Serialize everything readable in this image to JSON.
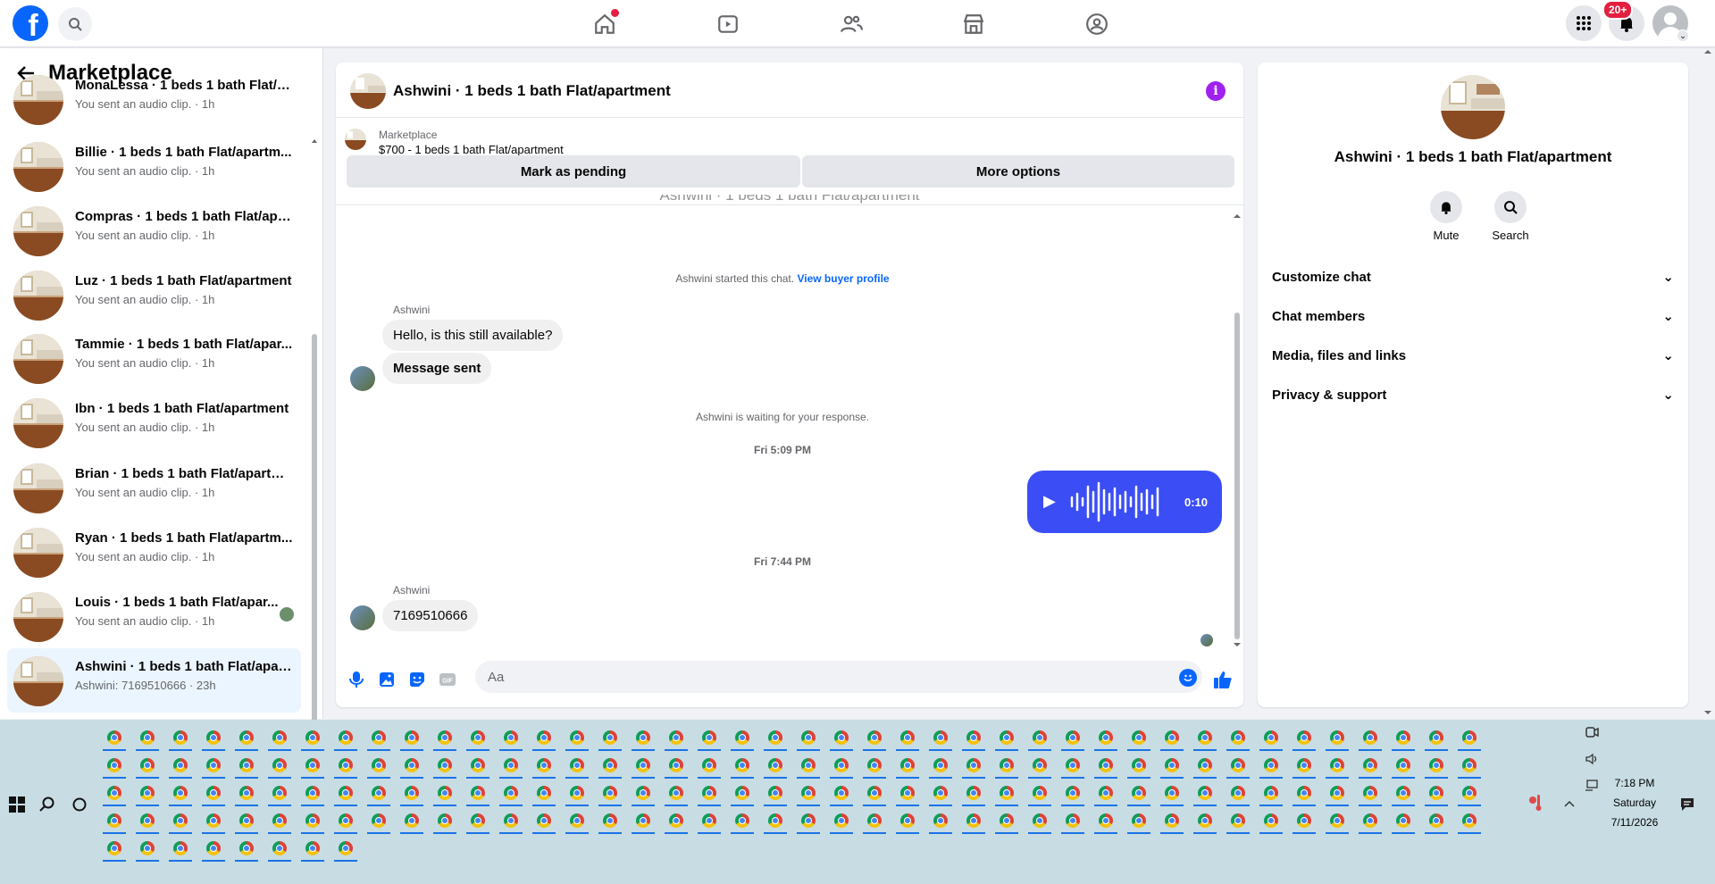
{
  "topbar": {
    "logo_letter": "f",
    "notification_badge": "20+",
    "nav_items": [
      "home",
      "watch",
      "friends",
      "marketplace",
      "groups"
    ]
  },
  "left": {
    "title": "Marketplace",
    "conversations": [
      {
        "name": "MonaLessa · 1 beds 1 bath Flat/a...",
        "sub": "You sent an audio clip. · 1h"
      },
      {
        "name": "Billie · 1 beds 1 bath Flat/apartm...",
        "sub": "You sent an audio clip. · 1h"
      },
      {
        "name": "Compras · 1 beds 1 bath Flat/apa...",
        "sub": "You sent an audio clip. · 1h"
      },
      {
        "name": "Luz · 1 beds 1 bath Flat/apartment",
        "sub": "You sent an audio clip. · 1h"
      },
      {
        "name": "Tammie · 1 beds 1 bath Flat/apar...",
        "sub": "You sent an audio clip. · 1h"
      },
      {
        "name": "Ibn · 1 beds 1 bath Flat/apartment",
        "sub": "You sent an audio clip. · 1h"
      },
      {
        "name": "Brian · 1 beds 1 bath Flat/apartm...",
        "sub": "You sent an audio clip. · 1h"
      },
      {
        "name": "Ryan · 1 beds 1 bath Flat/apartm...",
        "sub": "You sent an audio clip. · 1h"
      },
      {
        "name": "Louis · 1 beds 1 bath Flat/apar...",
        "sub": "You sent an audio clip. · 1h"
      },
      {
        "name": "Ashwini · 1 beds 1 bath Flat/apar...",
        "sub": "Ashwini: 7169510666 · 23h"
      }
    ]
  },
  "chat": {
    "title": "Ashwini · 1 beds 1 bath Flat/apartment",
    "marketplace_label": "Marketplace",
    "listing": "$700 - 1 beds 1 bath Flat/apartment",
    "btn_pending": "Mark as pending",
    "btn_more": "More options",
    "cut_title": "Ashwini · 1 beds 1 bath Flat/apartment",
    "started": "Ashwini started this chat.",
    "view_profile": "View buyer profile",
    "sender1": "Ashwini",
    "msg1": "Hello, is this still available?",
    "msg2": "Message sent",
    "waiting": "Ashwini is waiting for your response.",
    "ts1": "Fri 5:09 PM",
    "audio_duration": "0:10",
    "ts2": "Fri 7:44 PM",
    "sender2": "Ashwini",
    "msg3": "7169510666",
    "input_placeholder": "Aa"
  },
  "details": {
    "title": "Ashwini · 1 beds 1 bath Flat/apartment",
    "mute": "Mute",
    "search": "Search",
    "sections": [
      "Customize chat",
      "Chat members",
      "Media, files and links",
      "Privacy & support"
    ]
  },
  "taskbar": {
    "time": "7:18 PM",
    "day": "Saturday",
    "date": "7/11/2026"
  },
  "colors": {
    "accent": "#0866ff",
    "audio_bubble": "#3b4ef5",
    "badge": "#e41e3f",
    "info": "#a020f0"
  }
}
